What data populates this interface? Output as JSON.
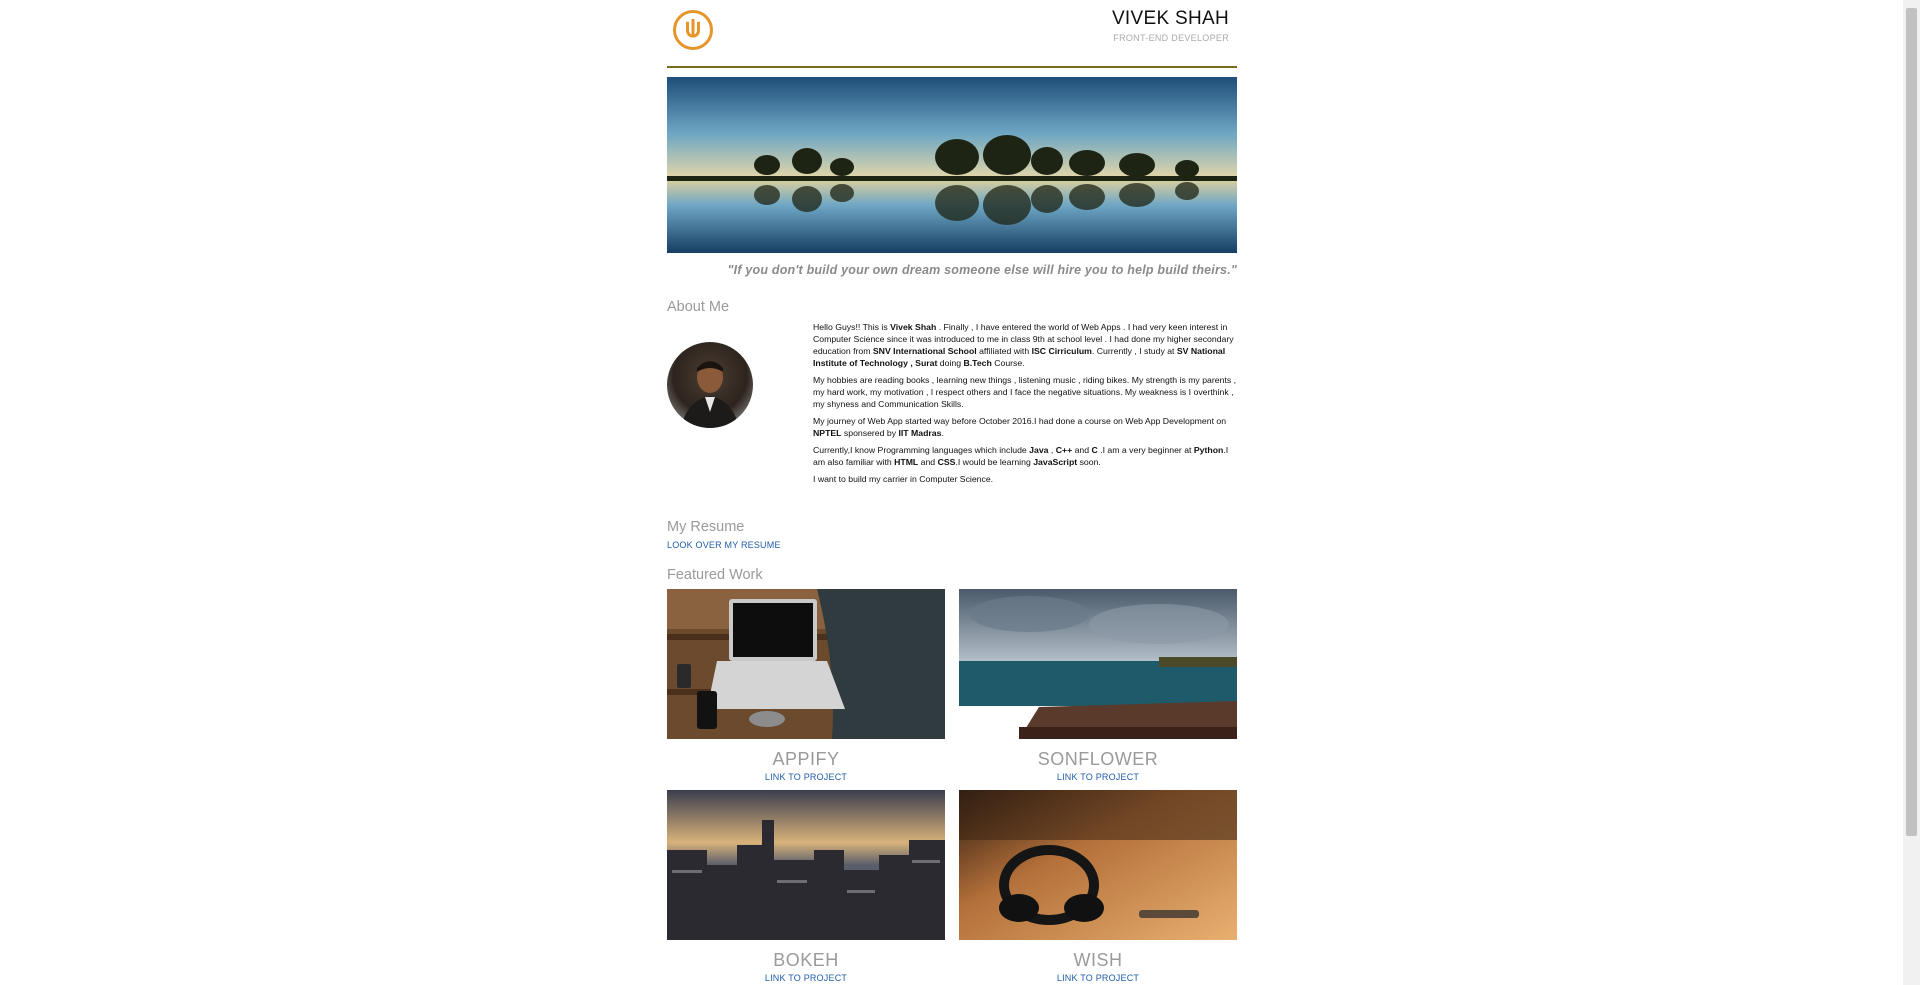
{
  "header": {
    "name": "VIVEK SHAH",
    "role": "FRONT-END DEVELOPER",
    "logo_icon": "power-u-logo"
  },
  "quote": "\"If you don't build your own dream someone else will hire you to help build theirs.\"",
  "about": {
    "title": "About Me",
    "p1_a": "Hello Guys!! This is ",
    "p1_b": "Vivek Shah",
    "p1_c": " . Finally , I have entered the world of Web Apps . I had very keen interest in Computer Science since it was introduced to me in class 9th at school level . I had done my higher secondary education from ",
    "p1_d": "SNV International School",
    "p1_e": " affiliated with ",
    "p1_f": "ISC Cirriculum",
    "p1_g": ". Currently , I study at ",
    "p1_h": "SV National Institute of Technology , Surat",
    "p1_i": " doing ",
    "p1_j": "B.Tech",
    "p1_k": " Course.",
    "p2": "My hobbies are reading books , learning new things , listening music , riding bikes. My strength is my parents , my hard work, my motivation , I respect others and I face the negative situations. My weakness is I overthink , my shyness and Communication Skills.",
    "p3_a": "My journey of Web App started way before October 2016.I had done a course on Web App Development on ",
    "p3_b": "NPTEL",
    "p3_c": " sponsered by ",
    "p3_d": "IIT Madras",
    "p3_e": ".",
    "p4_a": "Currently,I know Programming languages which include ",
    "p4_b": "Java",
    "p4_c": " , ",
    "p4_d": "C++",
    "p4_e": " and ",
    "p4_f": "C",
    "p4_g": " .I am a very beginner at ",
    "p4_h": "Python",
    "p4_i": ".I am also familiar with ",
    "p4_j": "HTML",
    "p4_k": " and ",
    "p4_l": "CSS",
    "p4_m": ".I would be learning ",
    "p4_n": "JavaScript",
    "p4_o": " soon.",
    "p5": "I want to build my carrier in Computer Science."
  },
  "resume": {
    "title": "My Resume",
    "link": "LOOK OVER MY RESUME"
  },
  "work": {
    "title": "Featured Work",
    "items": [
      {
        "title": "APPIFY",
        "link": "LINK TO PROJECT"
      },
      {
        "title": "SONFLOWER",
        "link": "LINK TO PROJECT"
      },
      {
        "title": "BOKEH",
        "link": "LINK TO PROJECT"
      },
      {
        "title": "WISH",
        "link": "LINK TO PROJECT"
      }
    ]
  },
  "colors": {
    "accent": "#e6952b",
    "link": "#1f5da8",
    "heading": "#9a9a9a",
    "rule": "#7a6a1a"
  }
}
